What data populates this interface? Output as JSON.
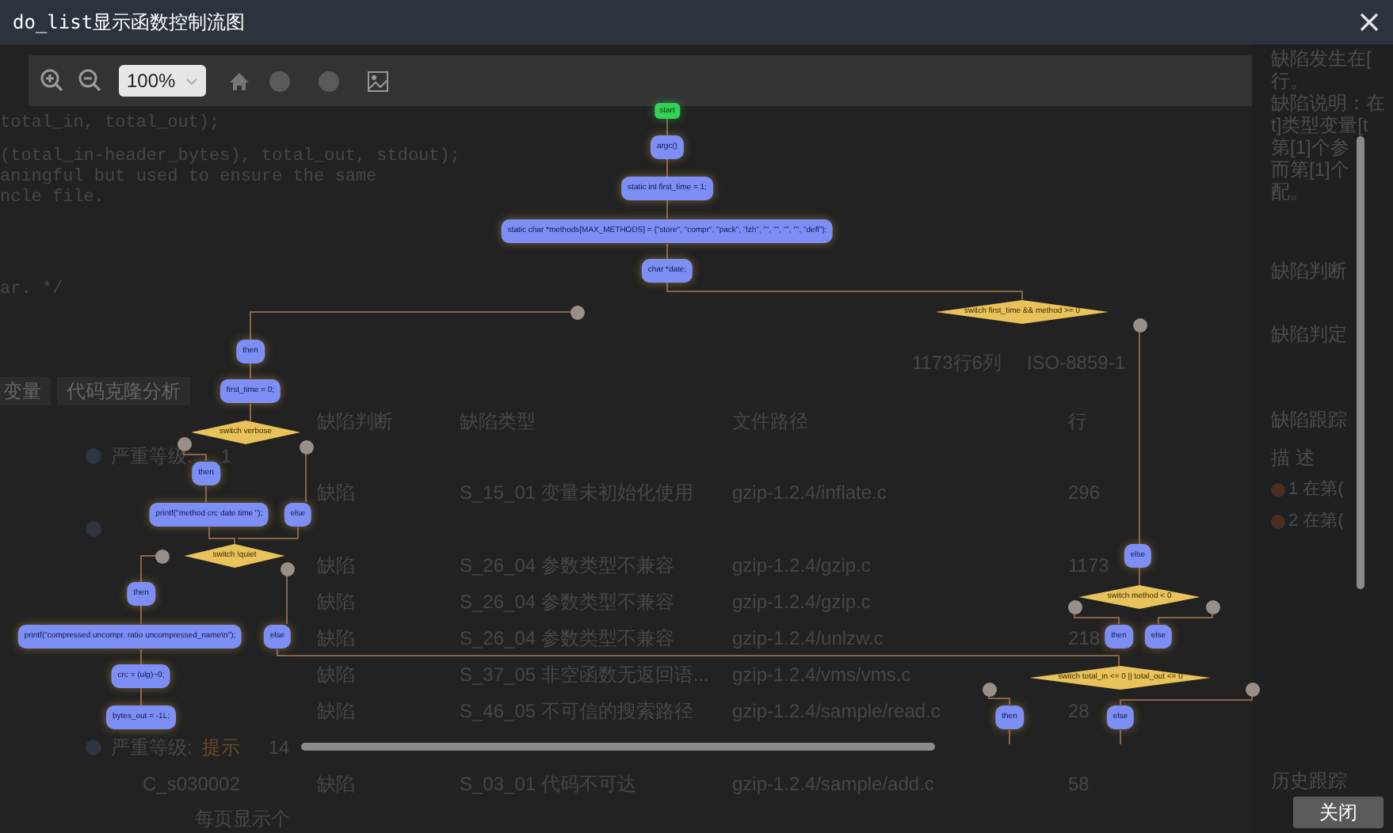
{
  "window": {
    "title": "do_list显示函数控制流图"
  },
  "toolbar": {
    "zoom_value": "100%"
  },
  "background_editor": {
    "code_lines": [
      "total_in, total_out);",
      "(total_in-header_bytes), total_out, stdout);",
      "aningful but used to ensure the same",
      "ncle file.",
      "ar. */"
    ],
    "status": [
      "1173行6列",
      "ISO-8859-1"
    ],
    "tabs": [
      "变量",
      "代码克隆分析"
    ],
    "columns": [
      "",
      "缺陷判断",
      "缺陷类型",
      "文件路径",
      "行"
    ],
    "rows": [
      {
        "kind": "group",
        "label": "严重等级:",
        "level": "",
        "count": "1"
      },
      {
        "kind": "defect",
        "cells": [
          "",
          "缺陷",
          "S_15_01 变量未初始化使用",
          "gzip-1.2.4/inflate.c",
          "296"
        ]
      },
      {
        "kind": "group",
        "label": "",
        "level": "",
        "count": ""
      },
      {
        "kind": "defect",
        "cells": [
          "",
          "缺陷",
          "S_26_04 参数类型不兼容",
          "gzip-1.2.4/gzip.c",
          "1173"
        ]
      },
      {
        "kind": "defect",
        "cells": [
          "",
          "缺陷",
          "S_26_04 参数类型不兼容",
          "gzip-1.2.4/gzip.c",
          ""
        ]
      },
      {
        "kind": "defect",
        "cells": [
          "",
          "缺陷",
          "S_26_04 参数类型不兼容",
          "gzip-1.2.4/unlzw.c",
          "218"
        ]
      },
      {
        "kind": "defect",
        "cells": [
          "",
          "缺陷",
          "S_37_05 非空函数无返回语...",
          "gzip-1.2.4/vms/vms.c",
          ""
        ]
      },
      {
        "kind": "defect",
        "cells": [
          "",
          "缺陷",
          "S_46_05 不可信的搜索路径",
          "gzip-1.2.4/sample/read.c",
          "28"
        ]
      },
      {
        "kind": "group",
        "label": "严重等级:",
        "level": "提示",
        "count": "14"
      },
      {
        "kind": "defect",
        "cells": [
          "C_s030002",
          "缺陷",
          "S_03_01 代码不可达",
          "gzip-1.2.4/sample/add.c",
          "58"
        ]
      }
    ],
    "pager": "每页显示个"
  },
  "side_panel": {
    "description_lines": [
      "缺陷发生在[",
      "行。",
      "缺陷说明：在",
      "t]类型变量[t",
      "第[1]个参",
      "而第[1]个",
      "配。"
    ],
    "sections": [
      "缺陷判断",
      "缺陷判定",
      "缺陷跟踪",
      "描 述"
    ],
    "trace_items": [
      "1 在第(",
      "2 在第("
    ],
    "history": "历史跟踪"
  },
  "flowchart": {
    "nodes": [
      {
        "kind": "start",
        "text": "start"
      },
      {
        "kind": "process",
        "text": "argc()"
      },
      {
        "kind": "process",
        "text": "static int first_time = 1;"
      },
      {
        "kind": "process",
        "text": "static char *methods[MAX_METHODS] = {\"store\", \"compr\", \"pack\", \"lzh\", \"\", \"\", \"\", \"\", \"defl\"};"
      },
      {
        "kind": "process",
        "text": "char *date;"
      },
      {
        "kind": "decision",
        "text": "switch first_time && method >= 0"
      },
      {
        "kind": "process",
        "text": "then"
      },
      {
        "kind": "process",
        "text": "first_time = 0;"
      },
      {
        "kind": "decision",
        "text": "switch verbose"
      },
      {
        "kind": "process",
        "text": "then"
      },
      {
        "kind": "process",
        "text": "printf(\"method  crc     date  time  \");"
      },
      {
        "kind": "process",
        "text": "else"
      },
      {
        "kind": "decision",
        "text": "switch !quiet"
      },
      {
        "kind": "process",
        "text": "then"
      },
      {
        "kind": "process",
        "text": "printf(\"compressed  uncompr. ratio uncompressed_name\\n\");"
      },
      {
        "kind": "process",
        "text": "else"
      },
      {
        "kind": "process",
        "text": "crc = (ulg)~0;"
      },
      {
        "kind": "process",
        "text": "bytes_out = -1L;"
      },
      {
        "kind": "process",
        "text": "else"
      },
      {
        "kind": "decision",
        "text": "switch method < 0"
      },
      {
        "kind": "process",
        "text": "then"
      },
      {
        "kind": "process",
        "text": "else"
      },
      {
        "kind": "decision",
        "text": "switch total_in <= 0 || total_out <= 0"
      },
      {
        "kind": "process",
        "text": "then"
      },
      {
        "kind": "process",
        "text": "else"
      }
    ]
  },
  "buttons": [
    "关闭"
  ]
}
